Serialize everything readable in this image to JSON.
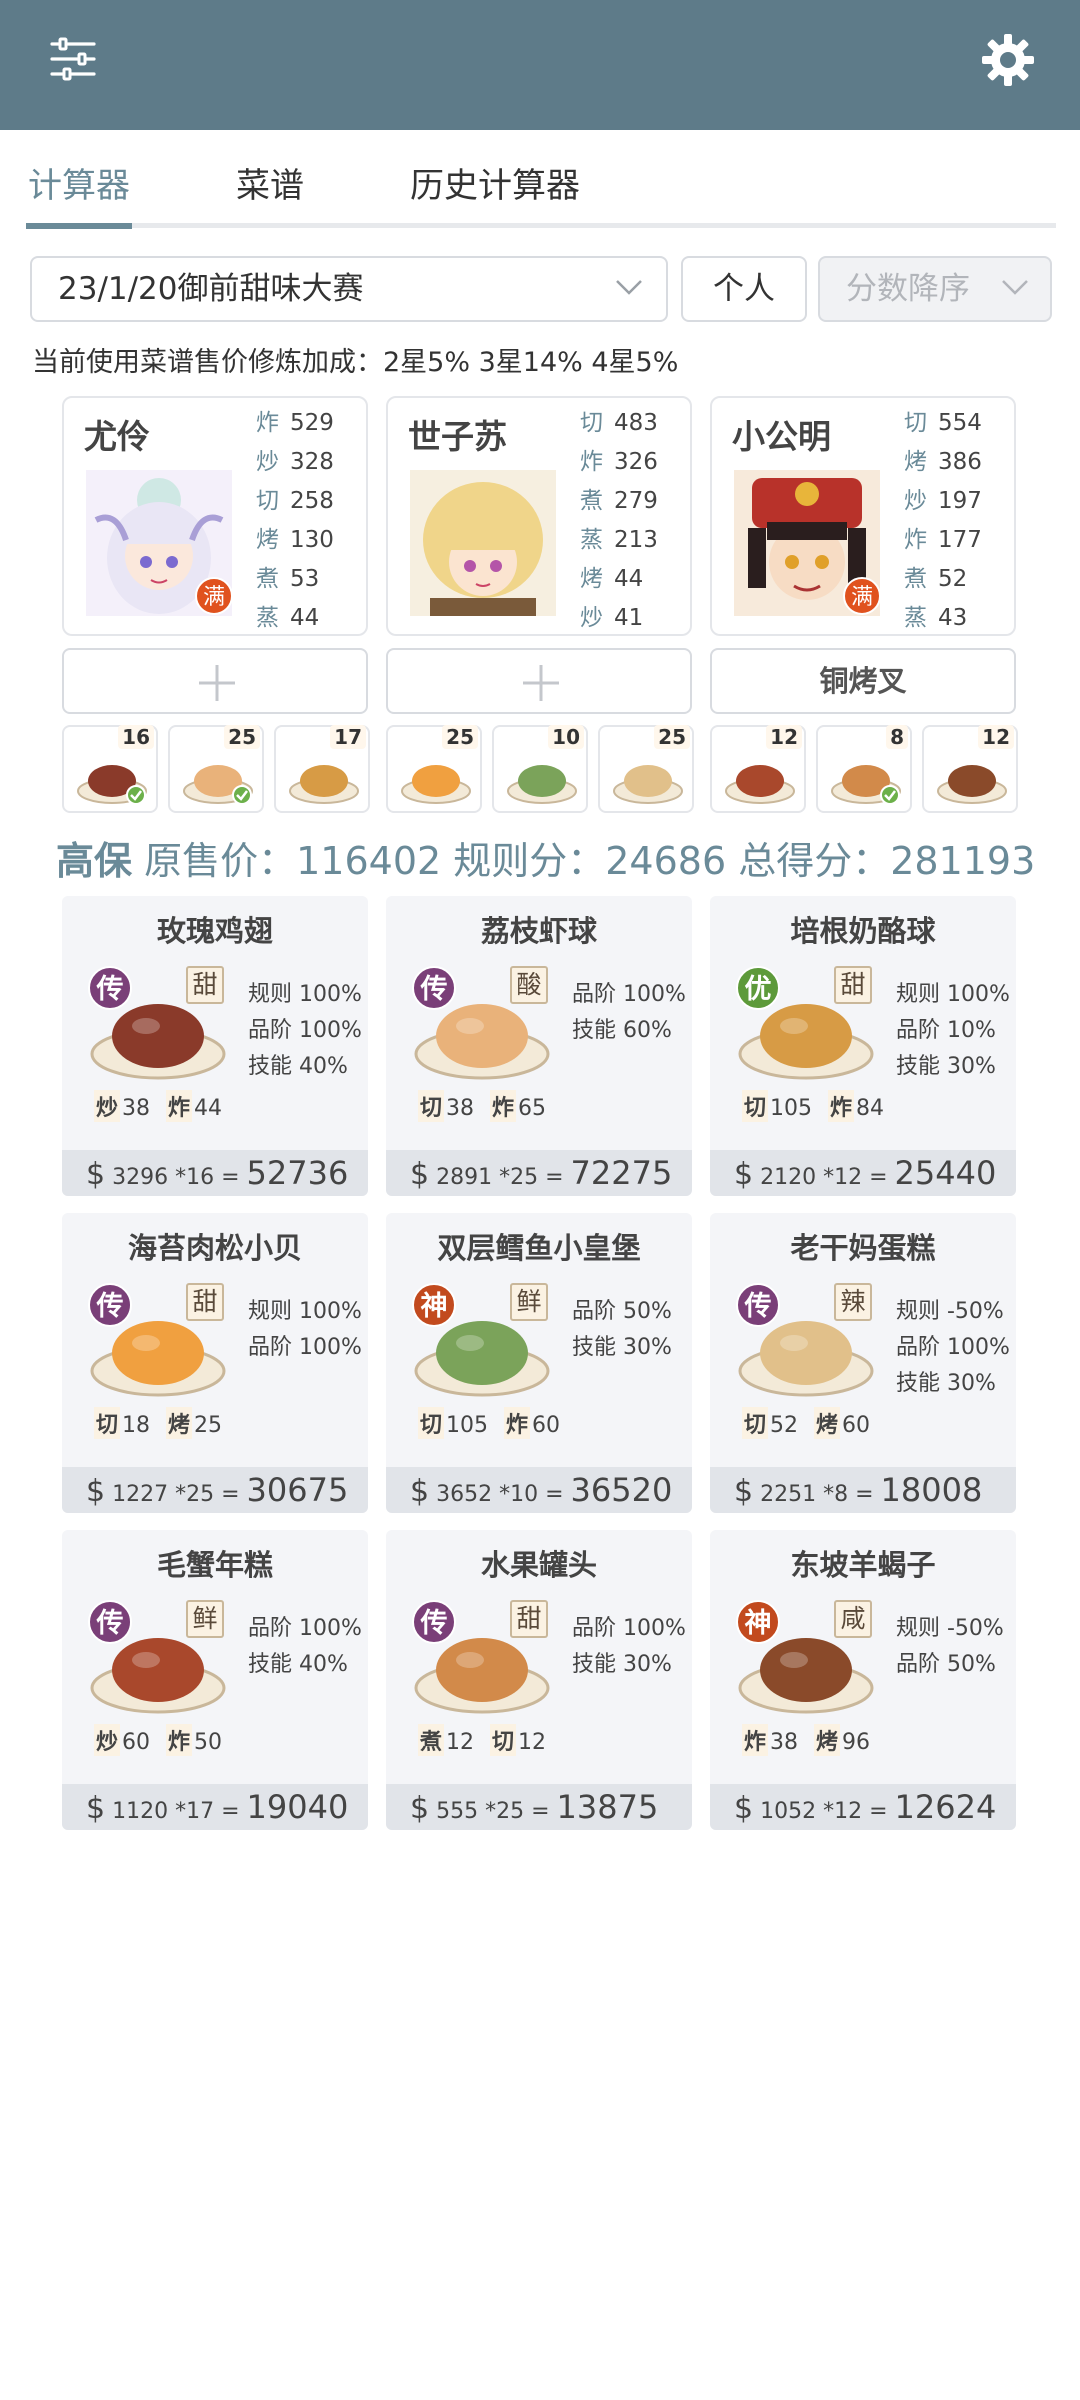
{
  "tabs": [
    "计算器",
    "菜谱",
    "历史计算器"
  ],
  "filters": {
    "contest": "23/1/20御前甜味大赛",
    "mode": "个人",
    "sort": "分数降序"
  },
  "bonus_text": "当前使用菜谱售价修炼加成：2星5% 3星14% 4星5%",
  "chefs": [
    {
      "name": "尤伶",
      "badge": "满",
      "stats": [
        [
          "炸",
          "529"
        ],
        [
          "炒",
          "328"
        ],
        [
          "切",
          "258"
        ],
        [
          "烤",
          "130"
        ],
        [
          "煮",
          "53"
        ],
        [
          "蒸",
          "44"
        ]
      ]
    },
    {
      "name": "世子苏",
      "badge": "",
      "stats": [
        [
          "切",
          "483"
        ],
        [
          "炸",
          "326"
        ],
        [
          "煮",
          "279"
        ],
        [
          "蒸",
          "213"
        ],
        [
          "烤",
          "44"
        ],
        [
          "炒",
          "41"
        ]
      ]
    },
    {
      "name": "小公明",
      "badge": "满",
      "stats": [
        [
          "切",
          "554"
        ],
        [
          "烤",
          "386"
        ],
        [
          "炒",
          "197"
        ],
        [
          "炸",
          "177"
        ],
        [
          "煮",
          "52"
        ],
        [
          "蒸",
          "43"
        ]
      ]
    }
  ],
  "equip": [
    "",
    "",
    "铜烤叉"
  ],
  "mini_dishes": [
    {
      "qty": "16",
      "check": true
    },
    {
      "qty": "25",
      "check": true
    },
    {
      "qty": "17",
      "check": false
    },
    {
      "qty": "25",
      "check": false
    },
    {
      "qty": "10",
      "check": false
    },
    {
      "qty": "25",
      "check": false
    },
    {
      "qty": "12",
      "check": false
    },
    {
      "qty": "8",
      "check": true
    },
    {
      "qty": "12",
      "check": false
    }
  ],
  "summary": {
    "tag": "高保",
    "text": "原售价：116402 规则分：24686 总得分：281193"
  },
  "recipes": [
    {
      "name": "玫瑰鸡翅",
      "rank": "传",
      "rank_color": "#7a3f78",
      "taste": "甜",
      "mods": [
        "规则 100%",
        "品阶 100%",
        "技能 40%"
      ],
      "reqs": [
        [
          "炒",
          "38"
        ],
        [
          "炸",
          "44"
        ]
      ],
      "price": "3296",
      "qty": "*16",
      "total": "52736",
      "dish_color": "#8a3a2a"
    },
    {
      "name": "荔枝虾球",
      "rank": "传",
      "rank_color": "#7a3f78",
      "taste": "酸",
      "mods": [
        "品阶 100%",
        "技能 60%"
      ],
      "reqs": [
        [
          "切",
          "38"
        ],
        [
          "炸",
          "65"
        ]
      ],
      "price": "2891",
      "qty": "*25",
      "total": "72275",
      "dish_color": "#e9b27a"
    },
    {
      "name": "培根奶酪球",
      "rank": "优",
      "rank_color": "#5d9a3a",
      "taste": "甜",
      "mods": [
        "规则 100%",
        "品阶 10%",
        "技能 30%"
      ],
      "reqs": [
        [
          "切",
          "105"
        ],
        [
          "炸",
          "84"
        ]
      ],
      "price": "2120",
      "qty": "*12",
      "total": "25440",
      "dish_color": "#d79b45"
    },
    {
      "name": "海苔肉松小贝",
      "rank": "传",
      "rank_color": "#7a3f78",
      "taste": "甜",
      "mods": [
        "规则 100%",
        "品阶 100%"
      ],
      "reqs": [
        [
          "切",
          "18"
        ],
        [
          "烤",
          "25"
        ]
      ],
      "price": "1227",
      "qty": "*25",
      "total": "30675",
      "dish_color": "#f0a040"
    },
    {
      "name": "双层鳕鱼小皇堡",
      "rank": "神",
      "rank_color": "#c24a1e",
      "taste": "鲜",
      "mods": [
        "品阶 50%",
        "技能 30%"
      ],
      "reqs": [
        [
          "切",
          "105"
        ],
        [
          "炸",
          "60"
        ]
      ],
      "price": "3652",
      "qty": "*10",
      "total": "36520",
      "dish_color": "#7ba35a"
    },
    {
      "name": "老干妈蛋糕",
      "rank": "传",
      "rank_color": "#7a3f78",
      "taste": "辣",
      "mods": [
        "规则 -50%",
        "品阶 100%",
        "技能 30%"
      ],
      "reqs": [
        [
          "切",
          "52"
        ],
        [
          "烤",
          "60"
        ]
      ],
      "price": "2251",
      "qty": "*8",
      "total": "18008",
      "dish_color": "#e1c08a"
    },
    {
      "name": "毛蟹年糕",
      "rank": "传",
      "rank_color": "#7a3f78",
      "taste": "鲜",
      "mods": [
        "品阶 100%",
        "技能 40%"
      ],
      "reqs": [
        [
          "炒",
          "60"
        ],
        [
          "炸",
          "50"
        ]
      ],
      "price": "1120",
      "qty": "*17",
      "total": "19040",
      "dish_color": "#a9482c"
    },
    {
      "name": "水果罐头",
      "rank": "传",
      "rank_color": "#7a3f78",
      "taste": "甜",
      "mods": [
        "品阶 100%",
        "技能 30%"
      ],
      "reqs": [
        [
          "煮",
          "12"
        ],
        [
          "切",
          "12"
        ]
      ],
      "price": "555",
      "qty": "*25",
      "total": "13875",
      "dish_color": "#d28a4a"
    },
    {
      "name": "东坡羊蝎子",
      "rank": "神",
      "rank_color": "#c24a1e",
      "taste": "咸",
      "mods": [
        "规则 -50%",
        "品阶 50%"
      ],
      "reqs": [
        [
          "炸",
          "38"
        ],
        [
          "烤",
          "96"
        ]
      ],
      "price": "1052",
      "qty": "*12",
      "total": "12624",
      "dish_color": "#8a4a2a"
    }
  ]
}
